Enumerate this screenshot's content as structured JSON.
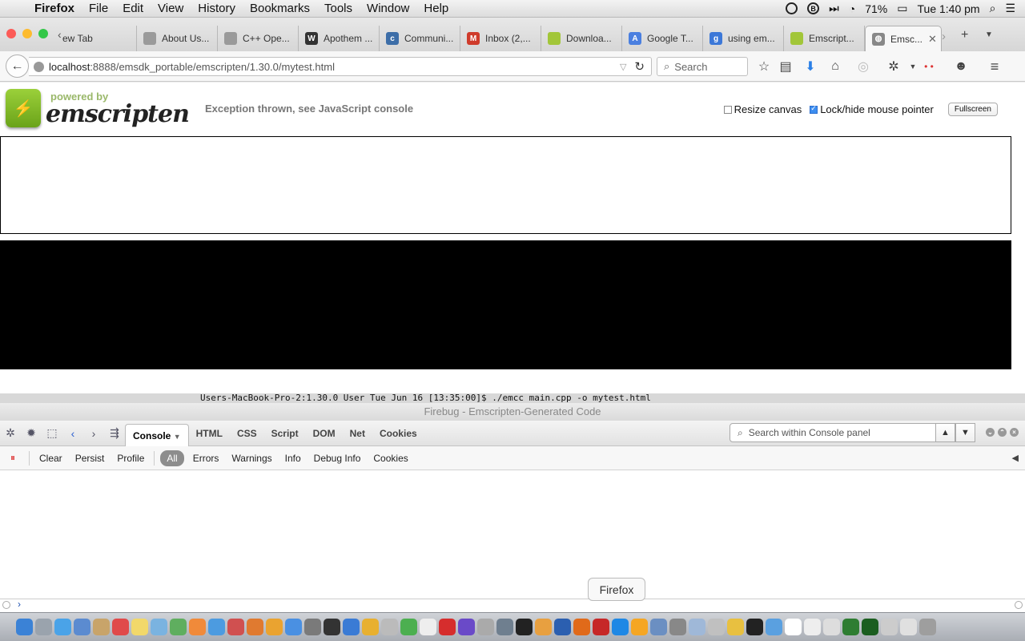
{
  "menubar": {
    "app": "Firefox",
    "items": [
      "File",
      "Edit",
      "View",
      "History",
      "Bookmarks",
      "Tools",
      "Window",
      "Help"
    ],
    "battery": "71%",
    "clock": "Tue 1:40 pm"
  },
  "tabs": [
    {
      "label": "ew Tab",
      "color": "#cccccc"
    },
    {
      "label": "About Us...",
      "color": "#9a9a9a"
    },
    {
      "label": "C++ Ope...",
      "color": "#9a9a9a"
    },
    {
      "label": "Apothem ...",
      "color": "#333333",
      "glyph": "W"
    },
    {
      "label": "Communi...",
      "color": "#3d6ea8",
      "glyph": "c"
    },
    {
      "label": "Inbox (2,...",
      "color": "#cf3b2b",
      "glyph": "M"
    },
    {
      "label": "Downloa...",
      "color": "#a2c639"
    },
    {
      "label": "Google T...",
      "color": "#4a7fe0",
      "glyph": "A"
    },
    {
      "label": "using em...",
      "color": "#3c78d8",
      "glyph": "g"
    },
    {
      "label": "Emscript...",
      "color": "#a2c639"
    }
  ],
  "active_tab": {
    "label": "Emsc...",
    "close": "✕"
  },
  "navbar": {
    "url_host": "localhost",
    "url_path": ":8888/emsdk_portable/emscripten/1.30.0/mytest.html",
    "search_placeholder": "Search"
  },
  "page": {
    "logo_powered": "powered by",
    "logo_brand": "emscripten",
    "status": "Exception thrown, see JavaScript console",
    "resize_label": "Resize canvas",
    "resize_checked": false,
    "lock_label": "Lock/hide mouse pointer",
    "lock_checked": true,
    "fullscreen_label": "Fullscreen"
  },
  "terminal_line": "Users-MacBook-Pro-2:1.30.0 User Tue Jun 16 [13:35:00]$ ./emcc main.cpp -o mytest.html",
  "firebug": {
    "title": "Firebug - Emscripten-Generated Code",
    "tabs": [
      "Console",
      "HTML",
      "CSS",
      "Script",
      "DOM",
      "Net",
      "Cookies"
    ],
    "active_tab": "Console",
    "search_placeholder": "Search within Console panel",
    "filters": [
      "Clear",
      "Persist",
      "Profile"
    ],
    "levels": [
      "All",
      "Errors",
      "Warnings",
      "Info",
      "Debug Info",
      "Cookies"
    ],
    "active_level": "All",
    "cmd_prompt": "›"
  },
  "dock_tooltip": "Firefox",
  "dock_colors": [
    "#3b82d6",
    "#9aa3ad",
    "#4aa3e8",
    "#5b8bd0",
    "#c8a46a",
    "#e04a4a",
    "#f2d86a",
    "#7ab3e0",
    "#5fae5f",
    "#f08a3a",
    "#4c9be0",
    "#d05050",
    "#e07a30",
    "#eaa330",
    "#4a90e2",
    "#7a7a7a",
    "#333333",
    "#3a7bd5",
    "#e8b030",
    "#bbbbbb",
    "#4caf50",
    "#eeeeee",
    "#d62d2d",
    "#6a4ac8",
    "#aaaaaa",
    "#6f7f8f",
    "#222222",
    "#e8a040",
    "#2b5fb0",
    "#e06a1a",
    "#c62828",
    "#1e88e5",
    "#f5a623",
    "#6b8fc2",
    "#888888",
    "#9fb8d8",
    "#c0c0c0",
    "#e8c040",
    "#222222",
    "#5aa0e0",
    "#ffffff",
    "#eeeeee",
    "#dddddd",
    "#2e7d32",
    "#1b5e20",
    "#cccccc",
    "#e0e0e0",
    "#9e9e9e"
  ]
}
